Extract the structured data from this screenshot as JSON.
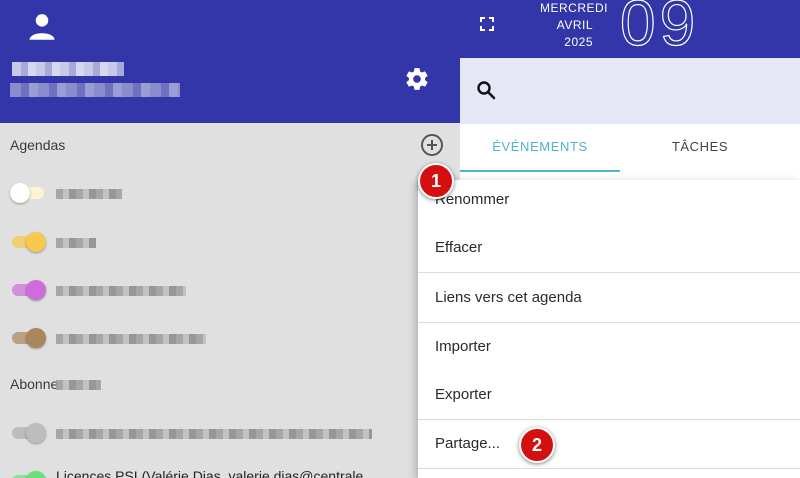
{
  "date": {
    "weekday": "MERCREDI",
    "month": "AVRIL",
    "year": "2025",
    "day": "09"
  },
  "sidebar": {
    "section_calendars": "Agendas",
    "section_subscriptions": "Abonne",
    "bottom_item": "Licences PSL(Valérie Dias, valerie.dias@centrale",
    "calendars": [
      {
        "color": "#fff3d6",
        "knob": "#ffffff",
        "state": "off"
      },
      {
        "color": "#f7c84a",
        "knob": "#f7c84a",
        "state": "on"
      },
      {
        "color": "#cf6bdb",
        "knob": "#cf6bdb",
        "state": "on"
      },
      {
        "color": "#a9865c",
        "knob": "#a9865c",
        "state": "on"
      }
    ],
    "subscriptions": [
      {
        "color": "#bdbdbd",
        "knob": "#bdbdbd",
        "state": "off"
      },
      {
        "color": "#69e07a",
        "knob": "#69e07a",
        "state": "on"
      }
    ]
  },
  "tabs": [
    {
      "label": "ÉVÉNEMENTS",
      "active": true
    },
    {
      "label": "TÂCHES",
      "active": false
    }
  ],
  "menu": {
    "items": [
      "Renommer",
      "Effacer",
      "Liens vers cet agenda",
      "Importer",
      "Exporter",
      "Partage..."
    ]
  },
  "markers": [
    "1",
    "2"
  ],
  "colors": {
    "header": "#3236a8",
    "accent": "#4fb3cc",
    "marker": "#d40f0f"
  },
  "icons": [
    "account-icon",
    "gear-icon",
    "add-circle-icon",
    "fullscreen-icon",
    "search-icon"
  ]
}
